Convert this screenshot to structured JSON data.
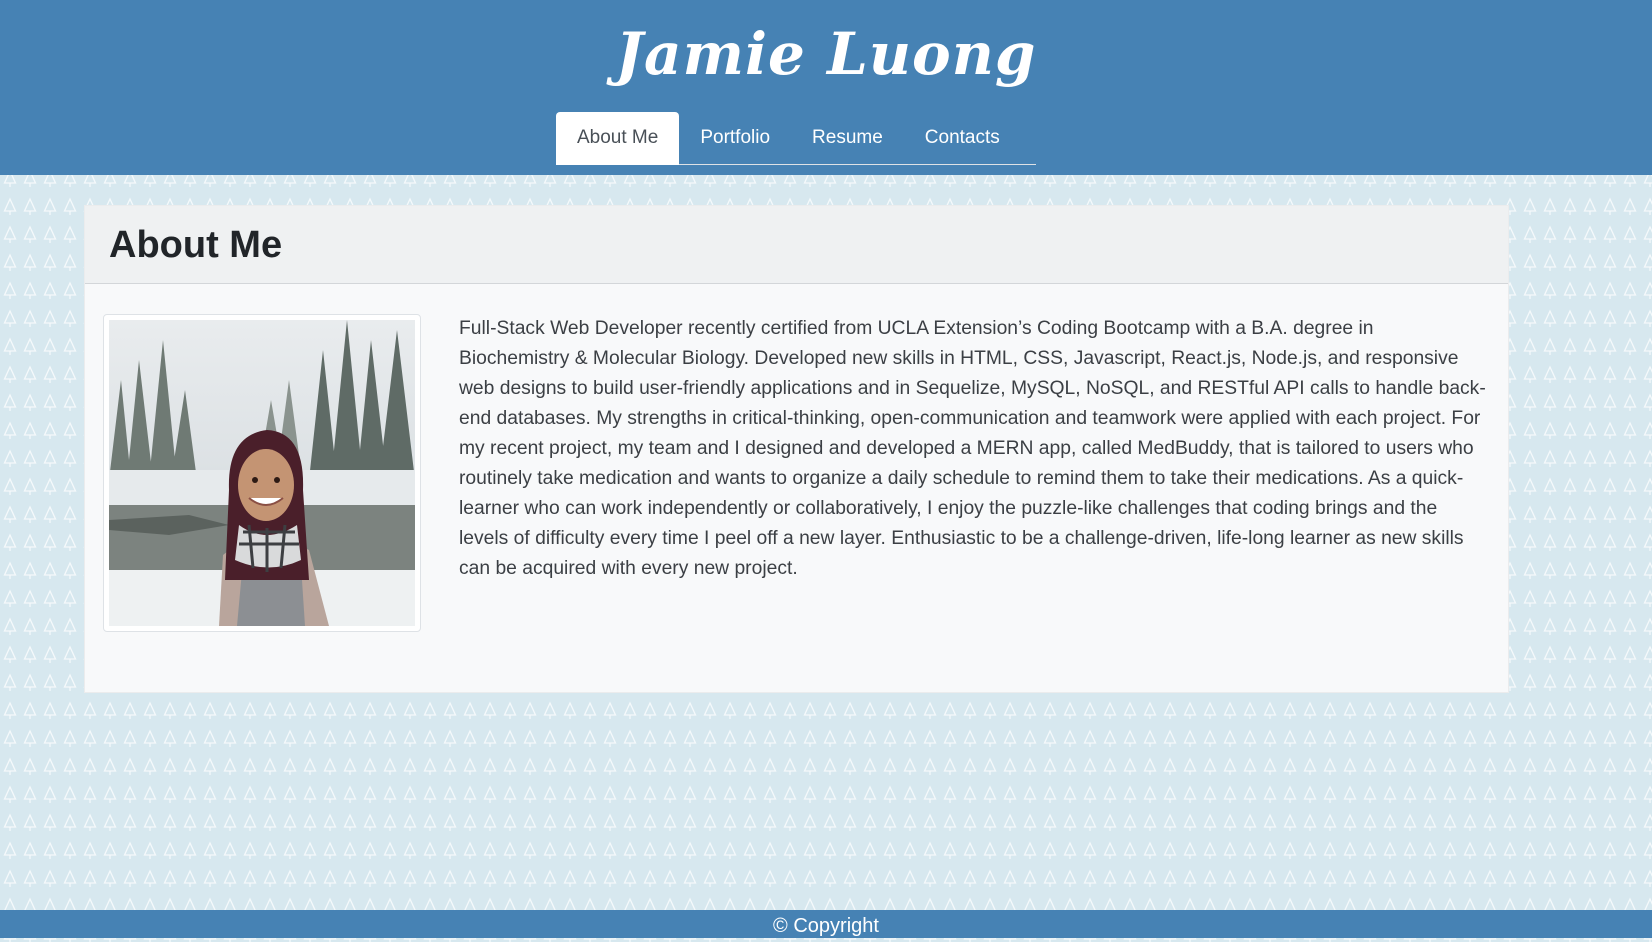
{
  "header": {
    "title": "Jamie Luong",
    "nav": [
      {
        "label": "About Me"
      },
      {
        "label": "Portfolio"
      },
      {
        "label": "Resume"
      },
      {
        "label": "Contacts"
      }
    ],
    "active_tab": "About Me"
  },
  "main": {
    "heading": "About Me",
    "photo_alt": "profile-photo",
    "bio": "Full-Stack Web Developer recently certified from UCLA Extension’s Coding Bootcamp with a B.A. degree in Biochemistry & Molecular Biology. Developed new skills in HTML, CSS, Javascript, React.js, Node.js, and responsive web designs to build user-friendly applications and in Sequelize, MySQL, NoSQL, and RESTful API calls to handle back-end databases. My strengths in critical-thinking, open-communication and teamwork were applied with each project. For my recent project, my team and I designed and developed a MERN app, called MedBuddy, that is tailored to users who routinely take medication and wants to organize a daily schedule to remind them to take their medications. As a quick-learner who can work independently or collaboratively, I enjoy the puzzle-like challenges that coding brings and the levels of difficulty every time I peel off a new layer. Enthusiastic to be a challenge-driven, life-long learner as new skills can be acquired with every new project."
  },
  "footer": {
    "copyright": "© Copyright"
  },
  "colors": {
    "header_bg": "#4682b4",
    "page_bg": "#d7e8ef",
    "card_bg": "#f8f9fa",
    "text": "#212529"
  }
}
